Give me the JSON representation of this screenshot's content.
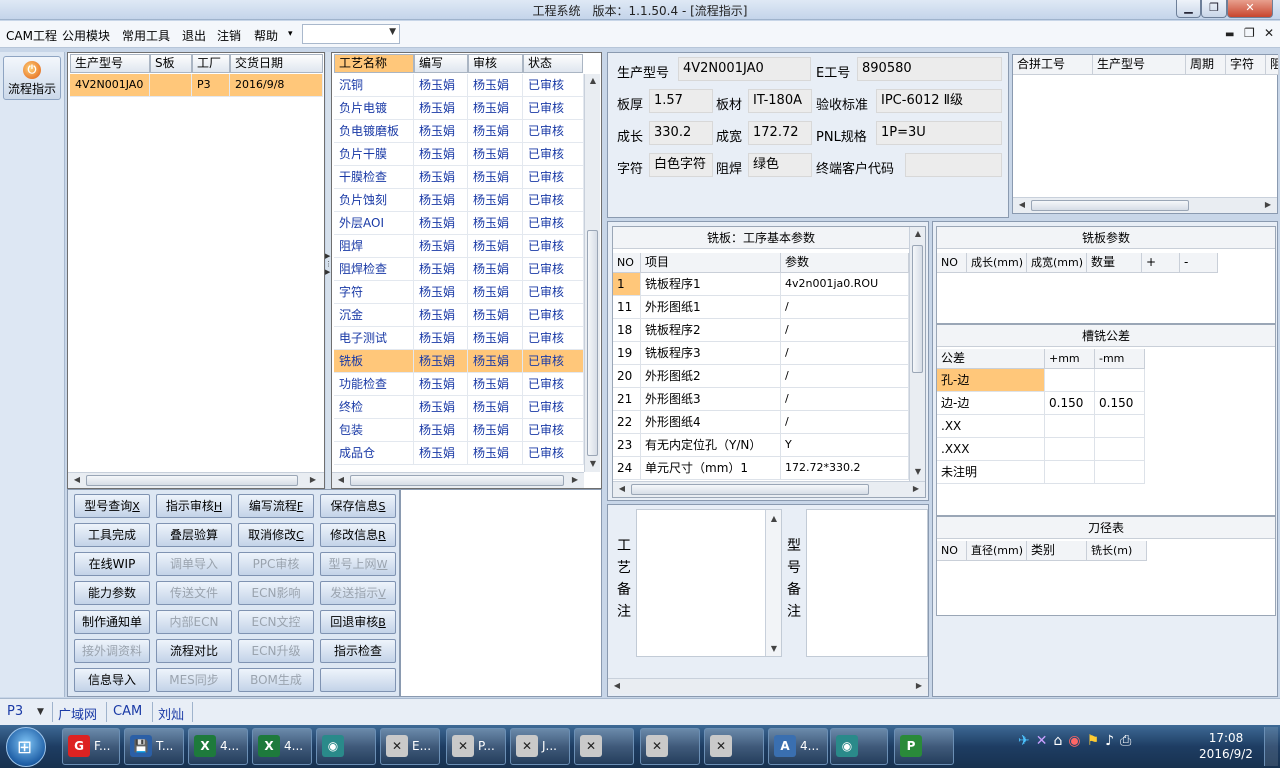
{
  "window": {
    "title": "工程系统　版本：1.1.50.4 - [流程指示]"
  },
  "menu": {
    "items": [
      "CAM工程",
      "公用模块",
      "常用工具",
      "退出",
      "注销",
      "帮助"
    ],
    "help_arrow": "▾"
  },
  "left_bar": {
    "button_label": "流程指示"
  },
  "model_grid": {
    "columns": [
      "生产型号",
      "S板",
      "工厂",
      "交货日期"
    ],
    "rows": [
      [
        "4V2N001JA0",
        "",
        "P3",
        "2016/9/8"
      ]
    ]
  },
  "process_grid": {
    "columns": [
      "工艺名称",
      "编写",
      "审核",
      "状态"
    ],
    "rows": [
      [
        "沉铜",
        "杨玉娟",
        "杨玉娟",
        "已审核"
      ],
      [
        "负片电镀",
        "杨玉娟",
        "杨玉娟",
        "已审核"
      ],
      [
        "负电镀磨板",
        "杨玉娟",
        "杨玉娟",
        "已审核"
      ],
      [
        "负片干膜",
        "杨玉娟",
        "杨玉娟",
        "已审核"
      ],
      [
        "干膜检查",
        "杨玉娟",
        "杨玉娟",
        "已审核"
      ],
      [
        "负片蚀刻",
        "杨玉娟",
        "杨玉娟",
        "已审核"
      ],
      [
        "外层AOI",
        "杨玉娟",
        "杨玉娟",
        "已审核"
      ],
      [
        "阻焊",
        "杨玉娟",
        "杨玉娟",
        "已审核"
      ],
      [
        "阻焊检查",
        "杨玉娟",
        "杨玉娟",
        "已审核"
      ],
      [
        "字符",
        "杨玉娟",
        "杨玉娟",
        "已审核"
      ],
      [
        "沉金",
        "杨玉娟",
        "杨玉娟",
        "已审核"
      ],
      [
        "电子测试",
        "杨玉娟",
        "杨玉娟",
        "已审核"
      ],
      [
        "铣板",
        "杨玉娟",
        "杨玉娟",
        "已审核"
      ],
      [
        "功能检查",
        "杨玉娟",
        "杨玉娟",
        "已审核"
      ],
      [
        "终检",
        "杨玉娟",
        "杨玉娟",
        "已审核"
      ],
      [
        "包装",
        "杨玉娟",
        "杨玉娟",
        "已审核"
      ],
      [
        "成品仓",
        "杨玉娟",
        "杨玉娟",
        "已审核"
      ]
    ],
    "selected_index": 12
  },
  "actions": [
    {
      "label": "型号查询",
      "key": "X",
      "enabled": true
    },
    {
      "label": "指示审核",
      "key": "H",
      "enabled": true
    },
    {
      "label": "编写流程",
      "key": "F",
      "enabled": true
    },
    {
      "label": "保存信息",
      "key": "S",
      "enabled": true
    },
    {
      "label": "工具完成",
      "key": "",
      "enabled": true
    },
    {
      "label": "叠层验算",
      "key": "",
      "enabled": true
    },
    {
      "label": "取消修改",
      "key": "C",
      "enabled": true
    },
    {
      "label": "修改信息",
      "key": "R",
      "enabled": true
    },
    {
      "label": "在线WIP",
      "key": "",
      "enabled": true
    },
    {
      "label": "调单导入",
      "key": "",
      "enabled": false
    },
    {
      "label": "PPC审核",
      "key": "",
      "enabled": false
    },
    {
      "label": "型号上网",
      "key": "W",
      "enabled": false
    },
    {
      "label": "能力参数",
      "key": "",
      "enabled": true
    },
    {
      "label": "传送文件",
      "key": "",
      "enabled": false
    },
    {
      "label": "ECN影响",
      "key": "",
      "enabled": false
    },
    {
      "label": "发送指示",
      "key": "V",
      "enabled": false
    },
    {
      "label": "制作通知单",
      "key": "",
      "enabled": true
    },
    {
      "label": "内部ECN",
      "key": "",
      "enabled": false
    },
    {
      "label": "ECN文控",
      "key": "",
      "enabled": false
    },
    {
      "label": "回退审核",
      "key": "B",
      "enabled": true
    },
    {
      "label": "接外调资料",
      "key": "",
      "enabled": false
    },
    {
      "label": "流程对比",
      "key": "",
      "enabled": true
    },
    {
      "label": "ECN升级",
      "key": "",
      "enabled": false
    },
    {
      "label": "指示检查",
      "key": "",
      "enabled": true
    },
    {
      "label": "信息导入",
      "key": "",
      "enabled": true
    },
    {
      "label": "MES同步",
      "key": "",
      "enabled": false
    },
    {
      "label": "BOM生成",
      "key": "",
      "enabled": false
    },
    {
      "label": "",
      "key": "",
      "enabled": true
    }
  ],
  "info": {
    "model_label": "生产型号",
    "model": "4V2N001JA0",
    "eno_label": "E工号",
    "eno": "890580",
    "thickness_label": "板厚",
    "thickness": "1.57",
    "material_label": "板材",
    "material": "IT-180A",
    "standard_label": "验收标准",
    "standard": "IPC-6012 Ⅱ级",
    "length_label": "成长",
    "length": "330.2",
    "width_label": "成宽",
    "width": "172.72",
    "pnl_label": "PNL规格",
    "pnl": "1P=3U",
    "char_label": "字符",
    "char": "白色字符",
    "mask_label": "阻焊",
    "mask": "绿色",
    "customer_label": "终端客户代码",
    "customer": ""
  },
  "merge_grid": {
    "columns": [
      "合拼工号",
      "生产型号",
      "周期",
      "字符",
      "阻"
    ]
  },
  "params": {
    "title": "铣板：工序基本参数",
    "columns": [
      "NO",
      "项目",
      "参数"
    ],
    "rows": [
      [
        "1",
        "铣板程序1",
        "4v2n001ja0.ROU"
      ],
      [
        "11",
        "外形图纸1",
        "/"
      ],
      [
        "18",
        "铣板程序2",
        "/"
      ],
      [
        "19",
        "铣板程序3",
        "/"
      ],
      [
        "20",
        "外形图纸2",
        "/"
      ],
      [
        "21",
        "外形图纸3",
        "/"
      ],
      [
        "22",
        "外形图纸4",
        "/"
      ],
      [
        "23",
        "有无内定位孔（Y/N）",
        "Y"
      ],
      [
        "24",
        "单元尺寸（mm）1",
        "172.72*330.2"
      ]
    ]
  },
  "mill_params": {
    "title": "铣板参数",
    "columns": [
      "NO",
      "成长(mm)",
      "成宽(mm)",
      "数量",
      "+",
      "-"
    ]
  },
  "slot_tol": {
    "title": "槽铣公差",
    "columns": [
      "公差",
      "+mm",
      "-mm"
    ],
    "rows": [
      [
        "孔-边",
        "",
        ""
      ],
      [
        "边-边",
        "0.150",
        "0.150"
      ],
      [
        ".XX",
        "",
        ""
      ],
      [
        ".XXX",
        "",
        ""
      ],
      [
        "未注明",
        "",
        ""
      ]
    ]
  },
  "tools": {
    "title": "刀径表",
    "columns": [
      "NO",
      "直径(mm)",
      "类别",
      "铣长(m)"
    ]
  },
  "remarks": {
    "process_label": "工艺备注",
    "model_label": "型号备注"
  },
  "status": {
    "factory": "P3",
    "net": "广域网",
    "mode": "CAM",
    "user": "刘灿"
  },
  "taskbar": {
    "items": [
      {
        "label": "F...",
        "icon": "G"
      },
      {
        "label": "T...",
        "icon": "💾"
      },
      {
        "label": "4...",
        "icon": "X"
      },
      {
        "label": "4...",
        "icon": "X"
      },
      {
        "label": "",
        "icon": "◉"
      },
      {
        "label": "E...",
        "icon": "✕"
      },
      {
        "label": "P...",
        "icon": "✕"
      },
      {
        "label": "J...",
        "icon": "✕"
      },
      {
        "label": "",
        "icon": "✕"
      },
      {
        "label": "",
        "icon": "✕"
      },
      {
        "label": "",
        "icon": "✕"
      },
      {
        "label": "4...",
        "icon": "A"
      },
      {
        "label": "",
        "icon": "◉"
      },
      {
        "label": "",
        "icon": "P"
      }
    ],
    "time": "17:08",
    "date": "2016/9/2"
  }
}
